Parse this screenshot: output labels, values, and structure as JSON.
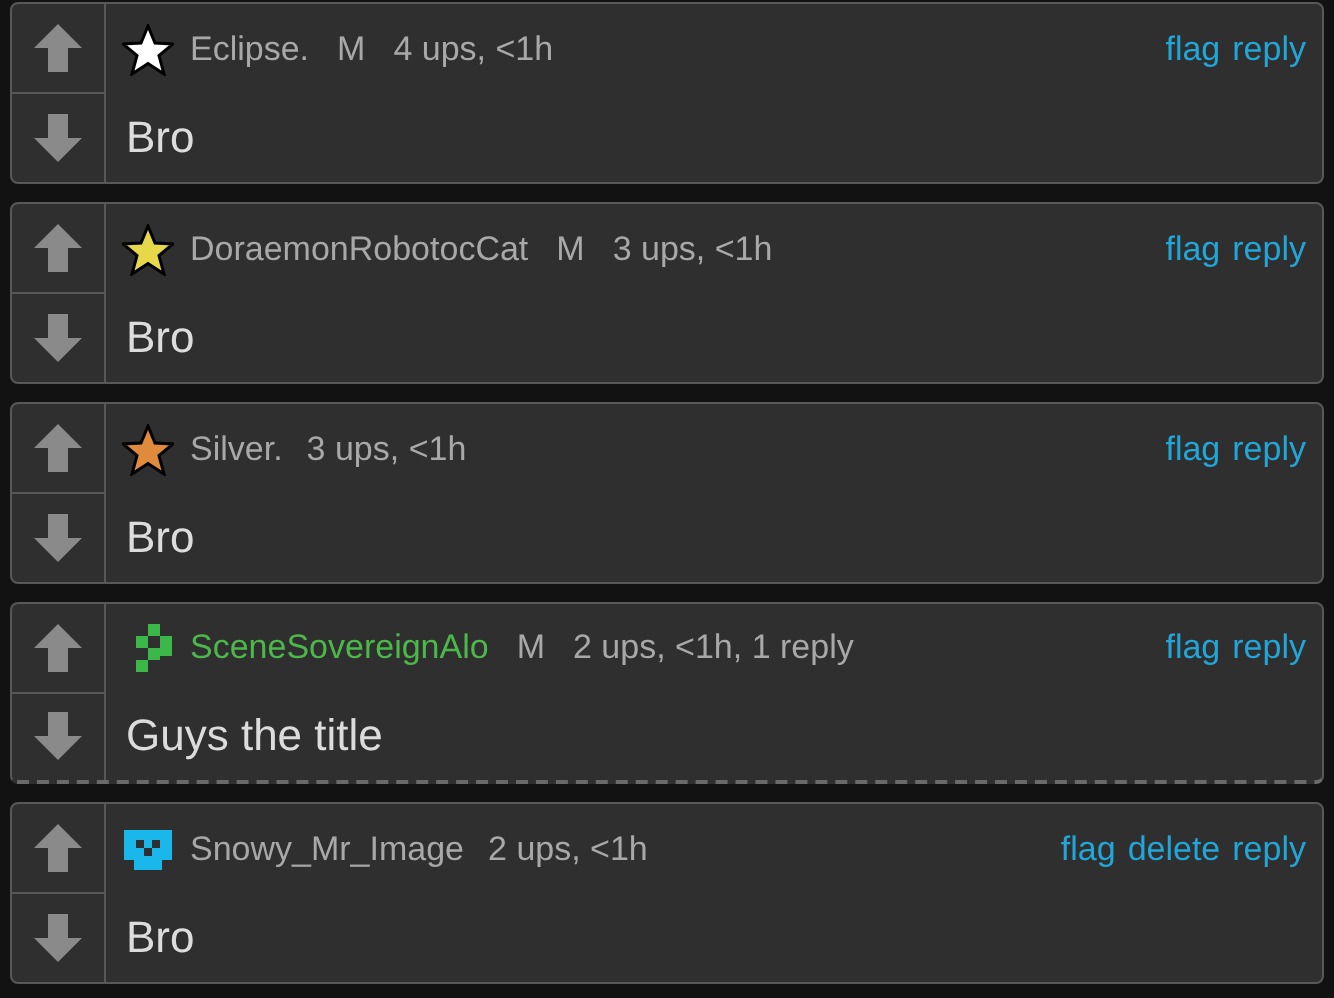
{
  "comments": [
    {
      "avatar": {
        "kind": "star",
        "color": "#ffffff"
      },
      "user": {
        "name": "Eclipse.",
        "color": "#a8a8a8"
      },
      "badge": "M",
      "meta": "4 ups, <1h",
      "actions": [
        "flag",
        "reply"
      ],
      "text": "Bro",
      "replies_collapsed": false
    },
    {
      "avatar": {
        "kind": "star",
        "color": "#e6d84a"
      },
      "user": {
        "name": "DoraemonRobotocCat",
        "color": "#a8a8a8"
      },
      "badge": "M",
      "meta": "3 ups, <1h",
      "actions": [
        "flag",
        "reply"
      ],
      "text": "Bro",
      "replies_collapsed": false
    },
    {
      "avatar": {
        "kind": "star",
        "color": "#e08a3c"
      },
      "user": {
        "name": "Silver.",
        "color": "#a8a8a8"
      },
      "meta": "3 ups, <1h",
      "actions": [
        "flag",
        "reply"
      ],
      "text": "Bro",
      "replies_collapsed": false
    },
    {
      "avatar": {
        "kind": "pixel",
        "color": "#3cb84a"
      },
      "user": {
        "name": "SceneSovereignAlo",
        "color": "#4cb84a"
      },
      "badge": "M",
      "meta": "2 ups, <1h, 1 reply",
      "actions": [
        "flag",
        "reply"
      ],
      "text": "Guys the title",
      "replies_collapsed": true
    },
    {
      "avatar": {
        "kind": "mask",
        "color": "#1ab8ea"
      },
      "user": {
        "name": "Snowy_Mr_Image",
        "color": "#a8a8a8"
      },
      "meta": "2 ups, <1h",
      "actions": [
        "flag",
        "delete",
        "reply"
      ],
      "text": "Bro",
      "replies_collapsed": false
    }
  ]
}
